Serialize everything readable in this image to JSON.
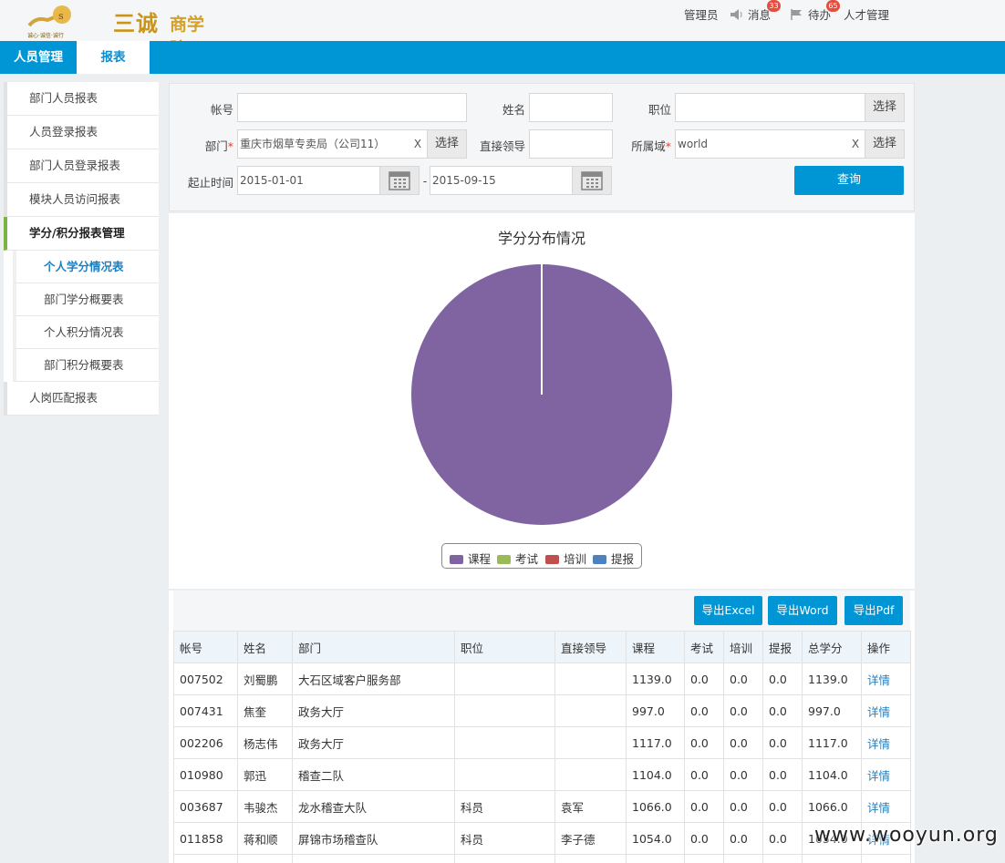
{
  "logo": {
    "sub": "诚心·诚信·诚行",
    "brand": "三诚",
    "suffix": "商学院"
  },
  "usermenu": {
    "admin": "管理员",
    "messages": "消息",
    "messages_count": "33",
    "todo": "待办",
    "todo_count": "65",
    "talent": "人才管理"
  },
  "nav": {
    "tabs": [
      {
        "label": "人员管理"
      },
      {
        "label": "报表"
      }
    ]
  },
  "sidebar": {
    "items": [
      {
        "label": "部门人员报表"
      },
      {
        "label": "人员登录报表"
      },
      {
        "label": "部门人员登录报表"
      },
      {
        "label": "模块人员访问报表"
      },
      {
        "label": "学分/积分报表管理"
      }
    ],
    "subitems": [
      {
        "label": "个人学分情况表"
      },
      {
        "label": "部门学分概要表"
      },
      {
        "label": "个人积分情况表"
      },
      {
        "label": "部门积分概要表"
      }
    ],
    "last": {
      "label": "人岗匹配报表"
    }
  },
  "filter": {
    "account_label": "帐号",
    "name_label": "姓名",
    "position_label": "职位",
    "dept_label": "部门",
    "dept_value": "重庆市烟草专卖局（公司11）",
    "leader_label": "直接领导",
    "domain_label": "所属域",
    "domain_value": "world",
    "date_label": "起止时间",
    "date_from": "2015-01-01",
    "date_sep": "-",
    "date_to": "2015-09-15",
    "select_label": "选择",
    "clear_label": "X",
    "required_mark": "*",
    "query_label": "查询"
  },
  "chart_data": {
    "type": "pie",
    "title": "学分分布情况",
    "categories": [
      "课程",
      "考试",
      "培训",
      "提报"
    ],
    "values": [
      100,
      0,
      0,
      0
    ],
    "colors": [
      "#8064a2",
      "#9bbb59",
      "#c0504d",
      "#4f81bd"
    ],
    "legend": "bottom-center"
  },
  "export": {
    "excel": "导出Excel",
    "word": "导出Word",
    "pdf": "导出Pdf"
  },
  "table": {
    "headers": [
      "帐号",
      "姓名",
      "部门",
      "职位",
      "直接领导",
      "课程",
      "考试",
      "培训",
      "提报",
      "总学分",
      "操作"
    ],
    "rows": [
      [
        "007502",
        "刘蜀鹏",
        "大石区域客户服务部",
        "",
        "",
        "1139.0",
        "0.0",
        "0.0",
        "0.0",
        "1139.0",
        "详情"
      ],
      [
        "007431",
        "焦奎",
        "政务大厅",
        "",
        "",
        "997.0",
        "0.0",
        "0.0",
        "0.0",
        "997.0",
        "详情"
      ],
      [
        "002206",
        "杨志伟",
        "政务大厅",
        "",
        "",
        "1117.0",
        "0.0",
        "0.0",
        "0.0",
        "1117.0",
        "详情"
      ],
      [
        "010980",
        "郭迅",
        "稽查二队",
        "",
        "",
        "1104.0",
        "0.0",
        "0.0",
        "0.0",
        "1104.0",
        "详情"
      ],
      [
        "003687",
        "韦骏杰",
        "龙水稽查大队",
        "科员",
        "袁军",
        "1066.0",
        "0.0",
        "0.0",
        "0.0",
        "1066.0",
        "详情"
      ],
      [
        "011858",
        "蒋和顺",
        "屏锦市场稽查队",
        "科员",
        "李子德",
        "1054.0",
        "0.0",
        "0.0",
        "0.0",
        "1054.0",
        "详情"
      ],
      [
        "",
        "",
        "",
        "",
        "",
        "",
        "",
        "",
        "",
        "",
        ""
      ]
    ]
  },
  "watermark": "www.wooyun.org"
}
